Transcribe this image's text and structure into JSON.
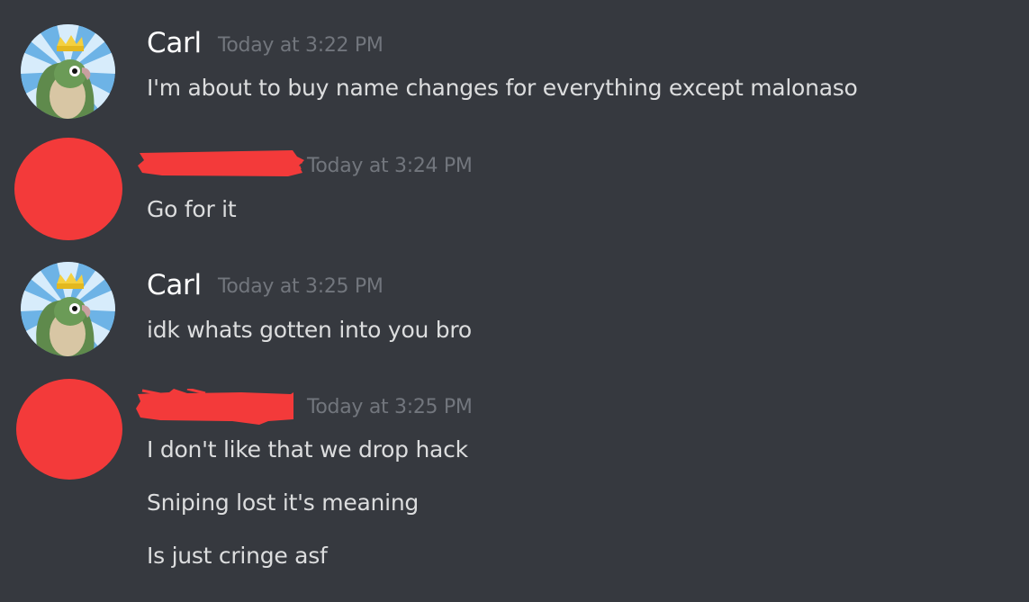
{
  "colors": {
    "background": "#36393f",
    "username": "#ffffff",
    "timestamp": "#72767d",
    "message_text": "#dcddde",
    "redaction": "#f33a3a"
  },
  "messages": [
    {
      "author": "Carl",
      "avatar": "parrot-with-crown-icon",
      "timestamp": "Today at 3:22 PM",
      "lines": [
        "I'm about to buy name changes for everything except malonaso"
      ]
    },
    {
      "author": "",
      "author_redacted": true,
      "avatar": "red-circle-redacted-avatar",
      "timestamp": "Today at 3:24 PM",
      "lines": [
        "Go for it"
      ]
    },
    {
      "author": "Carl",
      "avatar": "parrot-with-crown-icon",
      "timestamp": "Today at 3:25 PM",
      "lines": [
        "idk whats gotten into you bro"
      ]
    },
    {
      "author": "",
      "author_redacted": true,
      "avatar": "red-circle-redacted-avatar",
      "timestamp": "Today at 3:25 PM",
      "lines": [
        "I don't like that we drop hack",
        "Sniping lost it's meaning",
        "Is just cringe asf"
      ]
    }
  ]
}
